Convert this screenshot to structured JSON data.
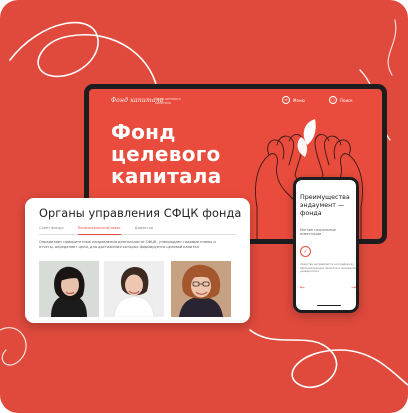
{
  "colors": {
    "background": "#df4a3c",
    "accent": "#e94b3c",
    "device_frame": "#1d1d1f"
  },
  "desktop": {
    "logo": "Фонд капитала",
    "logo_sub": "Фонд целевого капитала",
    "menu_label": "Меню",
    "menu_icon": "menu-icon",
    "search_label": "Поиск",
    "search_icon": "search-icon",
    "title_lines": [
      "Фонд",
      "целевого",
      "капитала"
    ]
  },
  "panel": {
    "title": "Органы управления СФЦК фонда",
    "tabs": [
      "Совет фонда",
      "Попечительский совет",
      "Директор"
    ],
    "active_tab": 1,
    "description": "Определяет приоритетные направления деятельности СФЦК, утверждает годовые планы и отчеты, определяет цели, для достижения которых формируется целевой капитал",
    "photos": [
      "woman-dark-hair-photo",
      "woman-white-blouse-photo",
      "woman-glasses-photo"
    ]
  },
  "phone": {
    "title": "Преимущества эндаумент — фонда",
    "subtitle": "Мягкие социальные инвестиции",
    "body": "Средства направляются на поддержку образовательных проектов и инициатив университета",
    "prev_icon": "arrow-left-icon",
    "next_icon": "arrow-right-icon"
  }
}
